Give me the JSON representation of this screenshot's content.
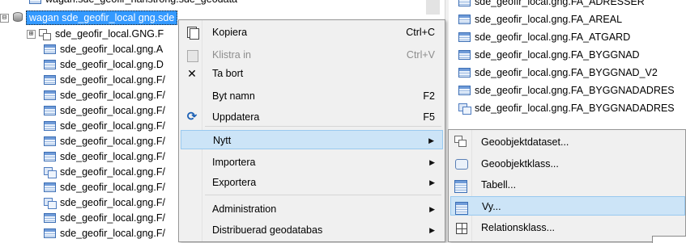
{
  "tree": {
    "cut_row": "wagan.sde_geofir_hanstrong.sde_geodata",
    "root": {
      "expander": "⊟",
      "label": "wagan sde_geofir_local gng.sde"
    },
    "children": [
      {
        "kind": "dataset",
        "expander": "⊞",
        "label": "sde_geofir_local.GNG.F"
      },
      {
        "kind": "table",
        "label": "sde_geofir_local.gng.A"
      },
      {
        "kind": "table",
        "label": "sde_geofir_local.gng.D"
      },
      {
        "kind": "table",
        "label": "sde_geofir_local.gng.F/"
      },
      {
        "kind": "table",
        "label": "sde_geofir_local.gng.F/"
      },
      {
        "kind": "table",
        "label": "sde_geofir_local.gng.F/"
      },
      {
        "kind": "table",
        "label": "sde_geofir_local.gng.F/"
      },
      {
        "kind": "table",
        "label": "sde_geofir_local.gng.F/"
      },
      {
        "kind": "table",
        "label": "sde_geofir_local.gng.F/"
      },
      {
        "kind": "featureclass",
        "label": "sde_geofir_local.gng.F/"
      },
      {
        "kind": "table",
        "label": "sde_geofir_local.gng.F/"
      },
      {
        "kind": "featureclass",
        "label": "sde_geofir_local.gng.F/"
      },
      {
        "kind": "table",
        "label": "sde_geofir_local.gng.F/"
      },
      {
        "kind": "table",
        "label": "sde_geofir_local.gng.F/"
      }
    ]
  },
  "right_list": [
    {
      "kind": "table",
      "label": "sde_geofir_local.gng.FA_ADRESSER"
    },
    {
      "kind": "table",
      "label": "sde_geofir_local.gng.FA_AREAL"
    },
    {
      "kind": "table",
      "label": "sde_geofir_local.gng.FA_ATGARD"
    },
    {
      "kind": "table",
      "label": "sde_geofir_local.gng.FA_BYGGNAD"
    },
    {
      "kind": "table",
      "label": "sde_geofir_local.gng.FA_BYGGNAD_V2"
    },
    {
      "kind": "table",
      "label": "sde_geofir_local.gng.FA_BYGGNADADRES"
    },
    {
      "kind": "featureclass",
      "label": "sde_geofir_local.gng.FA_BYGGNADADRES"
    }
  ],
  "context_menu": {
    "items": [
      {
        "name": "copy",
        "icon": "copy-icon",
        "label": "Kopiera",
        "shortcut": "Ctrl+C",
        "disabled": false
      },
      {
        "name": "paste",
        "icon": "paste-icon",
        "label": "Klistra in",
        "shortcut": "Ctrl+V",
        "disabled": true
      },
      {
        "name": "delete",
        "icon": "delete-icon",
        "label": "Ta bort",
        "shortcut": "",
        "disabled": false
      },
      {
        "name": "rename",
        "icon": "",
        "label": "Byt namn",
        "shortcut": "F2",
        "disabled": false
      },
      {
        "name": "refresh",
        "icon": "refresh-icon",
        "label": "Uppdatera",
        "shortcut": "F5",
        "disabled": false
      },
      {
        "name": "new",
        "icon": "",
        "label": "Nytt",
        "submenu": true,
        "highlighted": true
      },
      {
        "name": "import",
        "icon": "",
        "label": "Importera",
        "submenu": true
      },
      {
        "name": "export",
        "icon": "",
        "label": "Exportera",
        "submenu": true
      },
      {
        "name": "administration",
        "icon": "",
        "label": "Administration",
        "submenu": true
      },
      {
        "name": "distributed-geodatabase",
        "icon": "",
        "label": "Distribuerad geodatabas",
        "submenu": true
      }
    ]
  },
  "submenu": {
    "items": [
      {
        "name": "feature-dataset",
        "icon": "feature-dataset-icon",
        "label": "Geoobjektdataset..."
      },
      {
        "name": "feature-class",
        "icon": "feature-class-icon",
        "label": "Geoobjektklass..."
      },
      {
        "name": "table",
        "icon": "table-icon",
        "label": "Tabell..."
      },
      {
        "name": "view",
        "icon": "view-icon",
        "label": "Vy...",
        "highlighted": true
      },
      {
        "name": "relationship-class",
        "icon": "relationship-class-icon",
        "label": "Relationsklass..."
      }
    ]
  },
  "colors": {
    "selection": "#3399ff",
    "menu_bg": "#f0f0f0",
    "menu_hover": "#cce4f7"
  }
}
